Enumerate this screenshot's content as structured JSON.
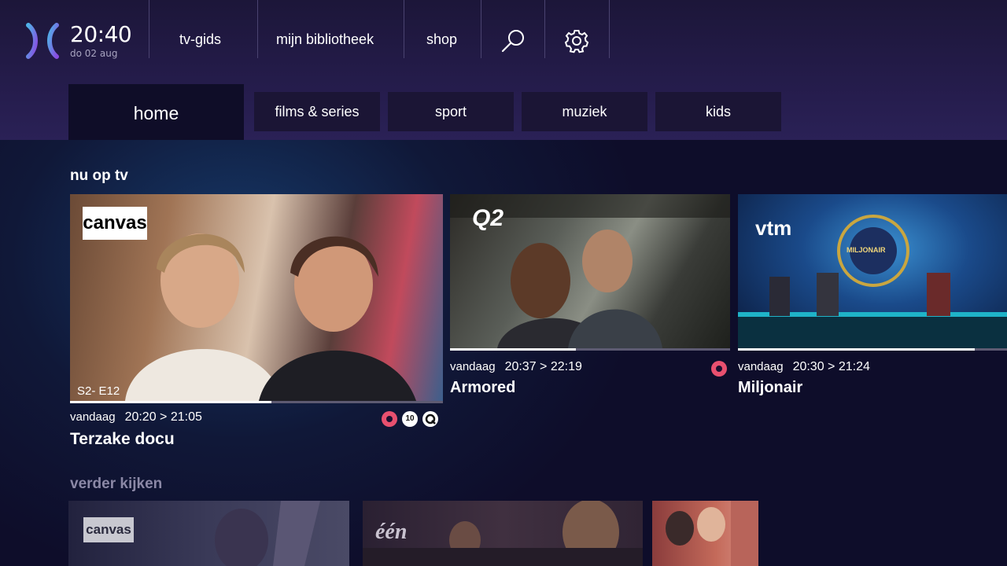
{
  "header": {
    "time": "20:40",
    "date": "do 02 aug",
    "nav": [
      {
        "label": "tv-gids"
      },
      {
        "label": "mijn bibliotheek"
      },
      {
        "label": "shop"
      }
    ],
    "icons": [
      "search-icon",
      "gear-icon"
    ]
  },
  "tabs": [
    {
      "label": "home",
      "active": true
    },
    {
      "label": "films & series"
    },
    {
      "label": "sport"
    },
    {
      "label": "muziek"
    },
    {
      "label": "kids"
    }
  ],
  "now_on_tv": {
    "title": "nu op tv",
    "cards": [
      {
        "channel": "canvas",
        "episode": "S2- E12",
        "day": "vandaag",
        "time": "20:20 > 21:05",
        "title": "Terzake docu",
        "progress": 0.54,
        "badge_10": "10"
      },
      {
        "channel": "Q2",
        "day": "vandaag",
        "time": "20:37 > 22:19",
        "title": "Armored",
        "progress": 0.45
      },
      {
        "channel": "vtm",
        "day": "vandaag",
        "time": "20:30 > 21:24",
        "title": "Miljonair",
        "progress": 0.88,
        "thumb_text": "MILJONAIR"
      }
    ]
  },
  "continue": {
    "title": "verder kijken",
    "cards": [
      {
        "channel": "canvas"
      },
      {
        "channel": "één"
      },
      {
        "channel": ""
      }
    ]
  },
  "colors": {
    "accent_rec": "#e8506f",
    "header_bg": "#261d4e",
    "tab_active": "#0f0d28"
  }
}
